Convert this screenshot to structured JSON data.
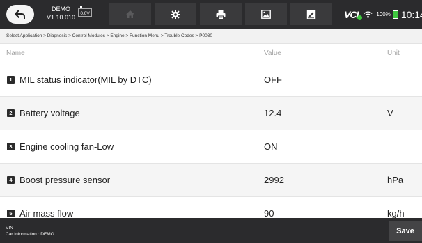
{
  "topbar": {
    "app_name": "DEMO",
    "version": "V1.10.010",
    "battery_voltage_label": "0.0V",
    "vci_label": "VCI",
    "battery_percent": "100%",
    "clock": "10:14",
    "nav_icons": [
      "home-icon",
      "gear-icon",
      "printer-icon",
      "image-icon",
      "edit-icon"
    ]
  },
  "breadcrumb": "Select Application > Diagnosis > Control Modules > Engine > Function Menu > Trouble Codes > P0030",
  "table": {
    "columns": {
      "name": "Name",
      "value": "Value",
      "unit": "Unit"
    },
    "rows": [
      {
        "num": "1",
        "name": "MIL status indicator(MIL by DTC)",
        "value": "OFF",
        "unit": ""
      },
      {
        "num": "2",
        "name": "Battery voltage",
        "value": "12.4",
        "unit": "V"
      },
      {
        "num": "3",
        "name": "Engine cooling fan-Low",
        "value": "ON",
        "unit": ""
      },
      {
        "num": "4",
        "name": "Boost pressure sensor",
        "value": "2992",
        "unit": "hPa"
      },
      {
        "num": "5",
        "name": "Air mass flow",
        "value": "90",
        "unit": "kg/h"
      }
    ]
  },
  "footer": {
    "vin": "VIN :",
    "car_info": "Car Information : DEMO",
    "save_label": "Save"
  },
  "colors": {
    "bar_bg": "#2b2b2d",
    "row_alt": "#f5f5f5",
    "accent_green": "#3fc83f"
  }
}
